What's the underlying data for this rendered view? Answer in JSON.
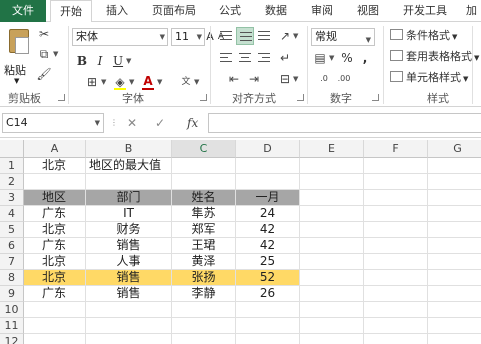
{
  "tabs": [
    {
      "label": "文件"
    },
    {
      "label": "开始"
    },
    {
      "label": "插入"
    },
    {
      "label": "页面布局"
    },
    {
      "label": "公式"
    },
    {
      "label": "数据"
    },
    {
      "label": "审阅"
    },
    {
      "label": "视图"
    },
    {
      "label": "开发工具"
    },
    {
      "label": "加"
    }
  ],
  "ribbon": {
    "paste_label": "粘贴",
    "font_name": "宋体",
    "font_size": "11",
    "bold": "B",
    "italic": "I",
    "underline": "U",
    "font_color_glyph": "A",
    "number_format": "常规",
    "percent": "%",
    "comma": ",",
    "groups": {
      "clipboard": "剪贴板",
      "font": "字体",
      "alignment": "对齐方式",
      "number": "数字",
      "styles": "样式"
    },
    "styles": {
      "conditional": "条件格式",
      "table": "套用表格格式",
      "cell": "单元格样式"
    }
  },
  "formula_bar": {
    "name_box": "C14",
    "cancel_glyph": "✕",
    "enter_glyph": "✓",
    "fx": "fx",
    "formula": ""
  },
  "grid": {
    "columns": [
      "A",
      "B",
      "C",
      "D",
      "E",
      "F",
      "G"
    ],
    "rows": [
      "1",
      "2",
      "3",
      "4",
      "5",
      "6",
      "7",
      "8",
      "9",
      "10",
      "11",
      "12"
    ],
    "cells": {
      "A1": "北京",
      "B1": "地区的最大值",
      "A3": "地区",
      "B3": "部门",
      "C3": "姓名",
      "D3": "一月",
      "A4": "广东",
      "B4": "IT",
      "C4": "隼苏",
      "D4": "24",
      "A5": "北京",
      "B5": "财务",
      "C5": "郑军",
      "D5": "42",
      "A6": "广东",
      "B6": "销售",
      "C6": "王珺",
      "D6": "42",
      "A7": "北京",
      "B7": "人事",
      "C7": "黄泽",
      "D7": "25",
      "A8": "北京",
      "B8": "销售",
      "C8": "张扬",
      "D8": "52",
      "A9": "广东",
      "B9": "销售",
      "C9": "李静",
      "D9": "26"
    },
    "highlight_color": "#ffd966",
    "header_fill": "#a6a6a6",
    "accent": "#217346"
  }
}
